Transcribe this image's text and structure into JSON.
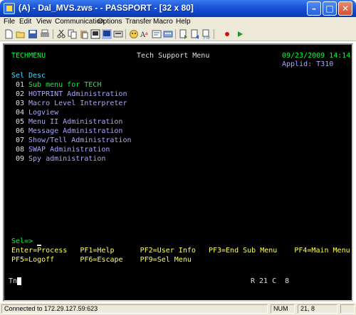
{
  "window": {
    "title": "(A) - Dal_MVS.zws - - PASSPORT - [32 x 80]",
    "min_label": "–",
    "max_label": "□",
    "close_label": "✕"
  },
  "menubar": {
    "items": [
      {
        "label": "File"
      },
      {
        "label": "Edit"
      },
      {
        "label": "View"
      },
      {
        "label": "Communication"
      },
      {
        "label": "Options"
      },
      {
        "label": "Transfer"
      },
      {
        "label": "Macro"
      },
      {
        "label": "Help"
      }
    ]
  },
  "toolbar": {
    "buttons": [
      {
        "icon": "new-document-icon"
      },
      {
        "icon": "open-folder-icon"
      },
      {
        "icon": "save-icon"
      },
      {
        "icon": "print-icon"
      },
      {
        "icon": "cut-icon"
      },
      {
        "icon": "copy-icon"
      },
      {
        "icon": "paste-icon"
      },
      {
        "icon": "screen-select-icon"
      },
      {
        "icon": "screen-icon"
      },
      {
        "icon": "keyboard-icon"
      },
      {
        "icon": "font-icon"
      },
      {
        "icon": "color-icon"
      },
      {
        "icon": "hotspot-icon"
      },
      {
        "icon": "keypad-icon"
      },
      {
        "icon": "send-file-icon"
      },
      {
        "icon": "receive-file-icon"
      },
      {
        "icon": "ftp-icon"
      },
      {
        "icon": "record-macro-icon"
      },
      {
        "icon": "play-macro-icon"
      }
    ]
  },
  "terminal": {
    "screen_id": "TECHMENU",
    "screen_title": "Tech Support Menu",
    "datetime": "09/23/2009 14:14",
    "applid": "Applid: T310",
    "header_sel": "Sel",
    "header_desc": "Desc",
    "items": [
      {
        "num": "01",
        "label": "Sub menu for TECH"
      },
      {
        "num": "02",
        "label": "HOTPRINT Administration"
      },
      {
        "num": "03",
        "label": "Macro Level Interpreter"
      },
      {
        "num": "04",
        "label": "Logview"
      },
      {
        "num": "05",
        "label": "Menu II Administration"
      },
      {
        "num": "06",
        "label": "Message Administration"
      },
      {
        "num": "07",
        "label": "Show/Tell Administration"
      },
      {
        "num": "08",
        "label": "SWAP Administration"
      },
      {
        "num": "09",
        "label": "Spy administration"
      }
    ],
    "sel_prompt": "Sel=>",
    "pfkeys_row1": "Enter=Process   PF1=Help      PF2=User Info   PF3=End Sub Menu    PF4=Main Menu",
    "pfkeys_row2": "PF5=Logoff      PF6=Escape    PF9=Sel Menu",
    "oia_left": "Tn",
    "oia_right": "R 21 C  8"
  },
  "statusbar": {
    "connection": "Connected to 172.29.127.59:623",
    "num": "NUM",
    "position": "21, 8"
  },
  "colors": {
    "terminal_bg": "#000000",
    "green": "#00ff40",
    "lavender": "#a8a8ff",
    "cyan": "#40e0ff",
    "yellow": "#ffff55",
    "titlebar": "#1c55d6"
  }
}
